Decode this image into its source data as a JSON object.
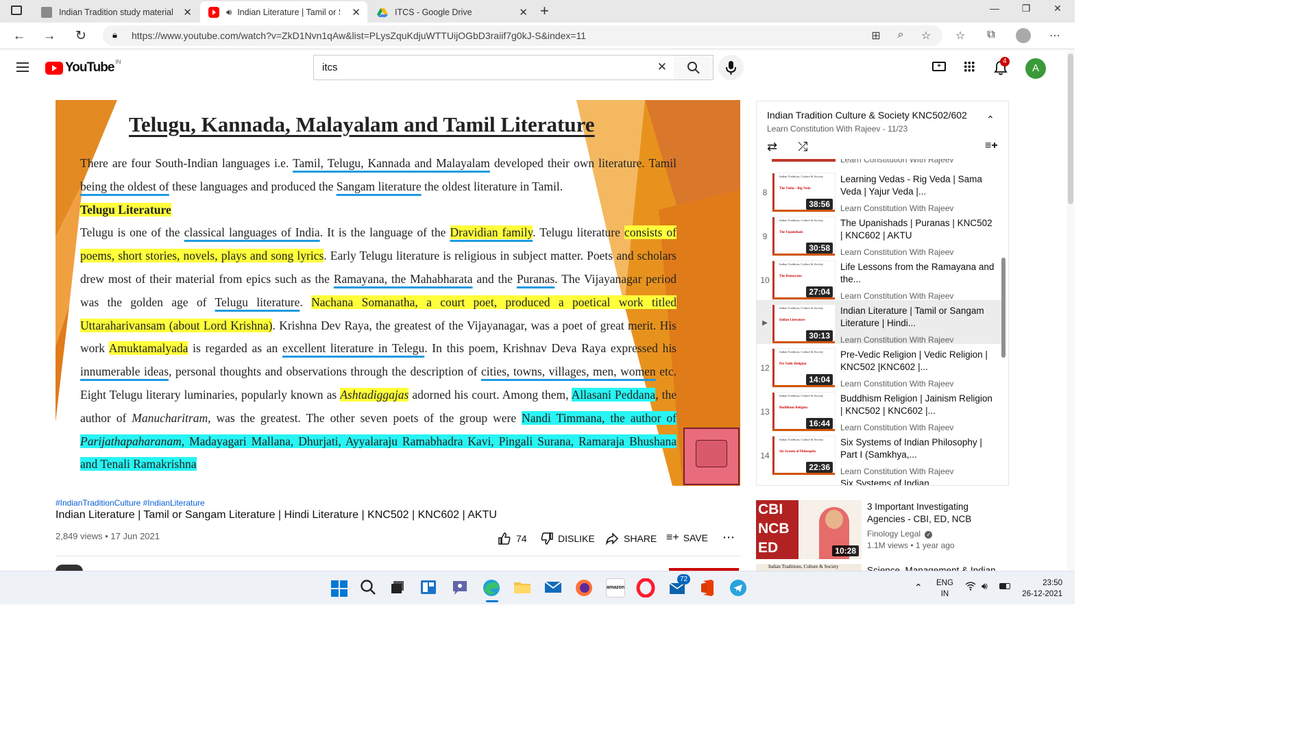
{
  "browser": {
    "tabs": [
      {
        "title": "Indian Tradition study material",
        "active": false
      },
      {
        "title": "Indian Literature | Tamil or S",
        "active": true
      },
      {
        "title": "ITCS - Google Drive",
        "active": false
      }
    ],
    "url": "https://www.youtube.com/watch?v=ZkD1Nvn1qAw&list=PLysZquKdjuWTTUijOGbD3raiif7g0kJ-S&index=11"
  },
  "youtube": {
    "logo_text": "YouTube",
    "country": "IN",
    "search_value": "itcs",
    "notifications": "4",
    "avatar_letter": "A"
  },
  "slide": {
    "title": "Telugu, Kannada, Malayalam and Tamil Literature",
    "p1_a": "There are four South-Indian languages i.e. ",
    "p1_b": "Tamil, Telugu, Kannada and Malayalam",
    "p1_c": " developed their own literature. Tamil ",
    "p1_d": "being the oldest of",
    "p1_e": " these languages and produced the ",
    "p1_f": "Sangam literature",
    "p1_g": " the oldest literature in Tamil.",
    "heading": "Telugu Literature",
    "p2_a": "Telugu is one of the ",
    "p2_b": "classical languages of India",
    "p2_c": ". It is the language of the ",
    "p2_d": "Dravidian family",
    "p2_e": ". Telugu literature ",
    "p2_f": "consists of poems, short stories, novels, plays and song lyrics",
    "p2_g": ". Early Telugu literature is religious in subject matter. Poets and scholars drew most of their material from epics such as the ",
    "p2_h": "Ramayana, the Mahabharata",
    "p2_i": " and the ",
    "p2_j": "Puranas",
    "p2_k": ". The Vijayanagar period was the golden age of ",
    "p2_l": "Telugu literature",
    "p2_m": ". ",
    "p2_n": "Nachana Somanatha, a court poet, produced a poetical work titled Uttaraharivansam (about Lord Krishna)",
    "p2_o": ". Krishna Dev Raya, the greatest of the Vijayanagar, was a poet of great merit. His work ",
    "p2_p": "Amuktamalyada",
    "p2_q": " is regarded as an ",
    "p2_r": "excellent literature in Telegu",
    "p2_s": ". In this poem, Krishnav Deva Raya expressed his ",
    "p2_t": "innumerable ideas",
    "p2_u": ", personal thoughts and observations through the description of ",
    "p2_v": "cities, towns, villages, men, women",
    "p2_w": " etc. Eight Telugu literary luminaries, popularly known as ",
    "p2_x": "Ashtadiggajas",
    "p2_y": " adorned his court. Among them, ",
    "p2_z": "Allasani Peddana",
    "p2_aa": ", the author of ",
    "p2_ab": "Manucharitram",
    "p2_ac": ", was the greatest. The other seven poets of the group were ",
    "p2_ad": "Nandi Timmana, the author of ",
    "p2_ae": "Parijathapaharanam",
    "p2_af": ", Madayagari Mallana, Dhurjati, Ayyalaraju Ramabhadra Kavi, Pingali Surana, Ramaraja Bhushana and Tenali Ramakrishna"
  },
  "video": {
    "hashtags": "#IndianTraditionCulture #IndianLiterature",
    "title": "Indian Literature | Tamil or Sangam Literature | Hindi Literature | KNC502 | KNC602 | AKTU",
    "views": "2,849 views • 17 Jun 2021",
    "likes": "74",
    "dislike_label": "DISLIKE",
    "share_label": "SHARE",
    "save_label": "SAVE"
  },
  "playlist": {
    "title": "Indian Tradition Culture & Society KNC502/602",
    "subtitle": "Learn Constitution With Rajeev - 11/23",
    "partial_top": "Learn Constitution With Rajeev",
    "items": [
      {
        "num": "8",
        "title": "Learning Vedas - Rig Veda | Sama Veda | Yajur Veda |...",
        "channel": "Learn Constitution With Rajeev",
        "duration": "38:56"
      },
      {
        "num": "9",
        "title": "The Upanishads | Puranas | KNC502 | KNC602 | AKTU",
        "channel": "Learn Constitution With Rajeev",
        "duration": "30:58"
      },
      {
        "num": "10",
        "title": "Life Lessons from the Ramayana and the...",
        "channel": "Learn Constitution With Rajeev",
        "duration": "27:04"
      },
      {
        "num": "▶",
        "title": "Indian Literature | Tamil or Sangam Literature | Hindi...",
        "channel": "Learn Constitution With Rajeev",
        "duration": "30:13"
      },
      {
        "num": "12",
        "title": "Pre-Vedic Religion | Vedic Religion | KNC502 |KNC602 |...",
        "channel": "Learn Constitution With Rajeev",
        "duration": "14:04"
      },
      {
        "num": "13",
        "title": "Buddhism Religion | Jainism Religion | KNC502 | KNC602 |...",
        "channel": "Learn Constitution With Rajeev",
        "duration": "16:44"
      },
      {
        "num": "14",
        "title": "Six Systems of Indian Philosophy | Part I (Samkhya,...",
        "channel": "Learn Constitution With Rajeev",
        "duration": "22:36"
      }
    ],
    "partial_bottom": "Six Systems of Indian"
  },
  "recommended": {
    "title": "3 Important Investigating Agencies - CBI, ED, NCB",
    "channel": "Finology Legal",
    "meta": "1.1M views • 1 year ago",
    "duration": "10:28",
    "thumb_words": [
      "CBI",
      "NCB",
      "ED"
    ],
    "next_partial": "Science, Management & Indian"
  },
  "taskbar": {
    "lang": "ENG",
    "region": "IN",
    "time": "23:50",
    "date": "26-12-2021",
    "mail_badge": "72"
  }
}
